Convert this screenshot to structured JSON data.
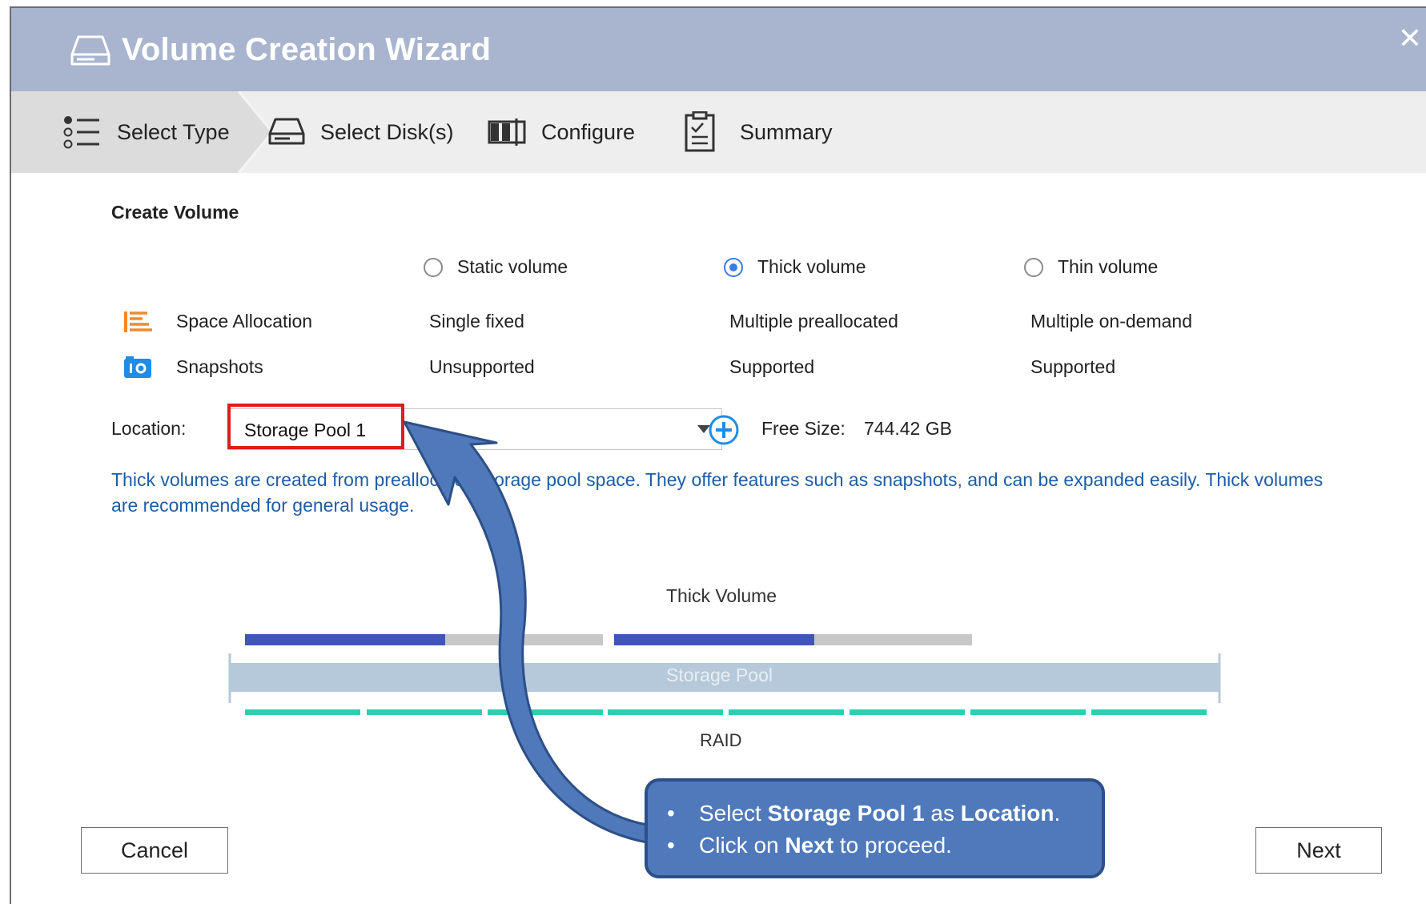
{
  "window": {
    "title": "Volume Creation Wizard",
    "close_glyph": "✕",
    "title_icon": "hard-drive-icon"
  },
  "steps": [
    {
      "label": "Select Type",
      "icon": "list-icon",
      "active": true
    },
    {
      "label": "Select Disk(s)",
      "icon": "disk-icon",
      "active": false
    },
    {
      "label": "Configure",
      "icon": "configure-icon",
      "active": false
    },
    {
      "label": "Summary",
      "icon": "clipboard-icon",
      "active": false
    }
  ],
  "section_title": "Create Volume",
  "volume_types": [
    {
      "label": "Static volume",
      "selected": false
    },
    {
      "label": "Thick volume",
      "selected": true
    },
    {
      "label": "Thin volume",
      "selected": false
    }
  ],
  "rows": [
    {
      "label": "Space Allocation",
      "icon": "space-allocation-icon",
      "values": [
        "Single fixed",
        "Multiple preallocated",
        "Multiple on-demand"
      ]
    },
    {
      "label": "Snapshots",
      "icon": "snapshot-icon",
      "values": [
        "Unsupported",
        "Supported",
        "Supported"
      ]
    }
  ],
  "location": {
    "label": "Location:",
    "value": "Storage Pool 1",
    "free_label": "Free Size:",
    "free_value": "744.42 GB"
  },
  "description": "Thick volumes are created from preallocated storage pool space. They offer features such as snapshots, and can be expanded easily. Thick volumes are recommended for general usage.",
  "diagram": {
    "title": "Thick Volume",
    "pool_label": "Storage Pool",
    "raid_label": "RAID"
  },
  "buttons": {
    "cancel": "Cancel",
    "next": "Next"
  },
  "callout": {
    "line1": {
      "pre": "Select ",
      "b1": "Storage Pool 1",
      "mid": " as ",
      "b2": "Location",
      "post": "."
    },
    "line2": {
      "pre": "Click on ",
      "b1": "Next",
      "post": " to proceed."
    }
  },
  "colors": {
    "titlebar": "#a9b4cf",
    "accent_blue": "#3a7ce0",
    "highlight_red": "#e21b1b",
    "volume_blue": "#3f56b3",
    "raid_teal": "#2ccfb0",
    "callout_blue": "#4f79ba"
  }
}
